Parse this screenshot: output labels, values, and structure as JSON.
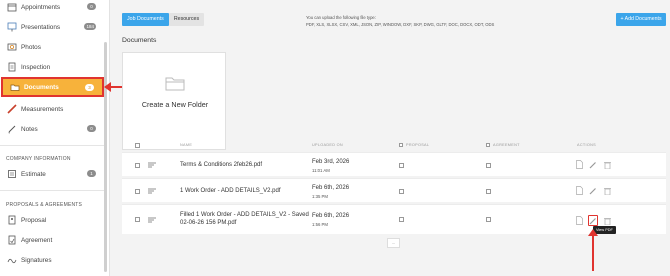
{
  "sidebar": {
    "items": [
      {
        "label": "Appointments",
        "badge": "0",
        "icon": "calendar-icon"
      },
      {
        "label": "Presentations",
        "badge": "184",
        "icon": "presentation-icon"
      },
      {
        "label": "Photos",
        "badge": "",
        "icon": "photo-icon"
      },
      {
        "label": "Inspection",
        "badge": "",
        "icon": "checklist-icon"
      },
      {
        "label": "Documents",
        "badge": "3",
        "icon": "folder-icon",
        "active": true
      },
      {
        "label": "Measurements",
        "badge": "",
        "icon": "ruler-icon"
      },
      {
        "label": "Notes",
        "badge": "0",
        "icon": "note-icon"
      }
    ],
    "company_section": "COMPANY INFORMATION",
    "company_items": [
      {
        "label": "Estimate",
        "badge": "1",
        "icon": "estimate-icon"
      }
    ],
    "proposals_section": "PROPOSALS & AGREEMENTS",
    "proposal_items": [
      {
        "label": "Proposal",
        "icon": "proposal-icon"
      },
      {
        "label": "Agreement",
        "icon": "agreement-icon"
      },
      {
        "label": "Signatures",
        "icon": "signature-icon"
      }
    ]
  },
  "tabs": {
    "job_documents": "Job Documents",
    "resources": "Resources"
  },
  "upload_note": {
    "line1": "You can upload the following file type:",
    "line2": "PDF, XLS, XLSX, CSV, XML, JSON, ZIP, WINDOW, DXF, SKP, DWG, GLTF, DOC, DOCX, ODT, ODS"
  },
  "add_button": "+ Add Documents",
  "page_title": "Documents",
  "folder_card_label": "Create a New Folder",
  "table": {
    "headers": {
      "name": "NAME",
      "uploaded_on": "UPLOADED ON",
      "proposal": "PROPOSAL",
      "agreement": "AGREEMENT",
      "actions": "ACTIONS"
    },
    "rows": [
      {
        "name_line1": "Terms & Conditions 2feb26.pdf",
        "name_line2": "",
        "date": "Feb 3rd, 2026",
        "time": "11:01 AM"
      },
      {
        "name_line1": "1 Work Order - ADD DETAILS_V2.pdf",
        "name_line2": "",
        "date": "Feb 6th, 2026",
        "time": "1:35 PM"
      },
      {
        "name_line1": "Filled 1 Work Order - ADD DETAILS_V2 - Saved",
        "name_line2": "02-06-26 156 PM.pdf",
        "date": "Feb 6th, 2026",
        "time": "1:56 PM"
      }
    ]
  },
  "tooltip": "View PDF",
  "pager_label": "...",
  "colors": {
    "accent": "#3ba5ea",
    "active_nav": "#f7b23b",
    "annotation": "#e0342f"
  }
}
